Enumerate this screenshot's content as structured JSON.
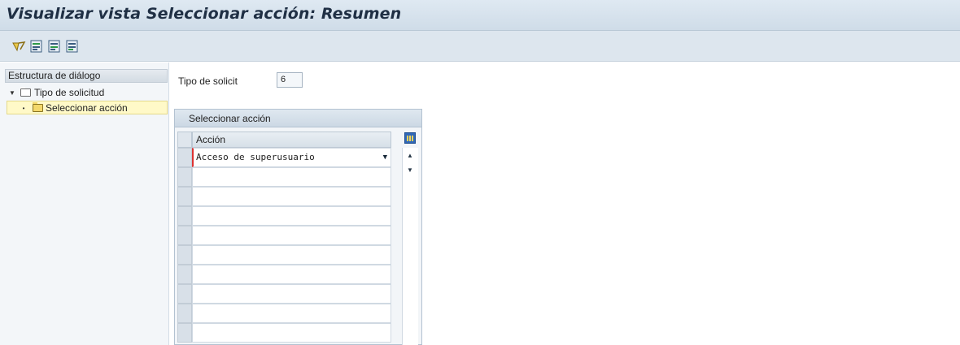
{
  "window": {
    "title": "Visualizar vista Seleccionar acción: Resumen"
  },
  "toolbar": {
    "icons": [
      "glasses-display-icon",
      "table-icon-1",
      "table-icon-2",
      "table-icon-3"
    ]
  },
  "tree": {
    "header": "Estructura de diálogo",
    "items": [
      {
        "label": "Tipo de solicitud",
        "expanded": true,
        "selected": false
      },
      {
        "label": "Seleccionar acción",
        "expanded": false,
        "selected": true
      }
    ]
  },
  "form": {
    "tipo_label": "Tipo de solicit",
    "tipo_value": "6"
  },
  "table": {
    "title": "Seleccionar acción",
    "column_header": "Acción",
    "rows": [
      "Acceso de superusuario",
      "",
      "",
      "",
      "",
      "",
      "",
      "",
      "",
      ""
    ]
  },
  "colors": {
    "title_bar": "#d8e4ee",
    "selection": "#fff9c8",
    "required_marker": "#dd3333"
  }
}
